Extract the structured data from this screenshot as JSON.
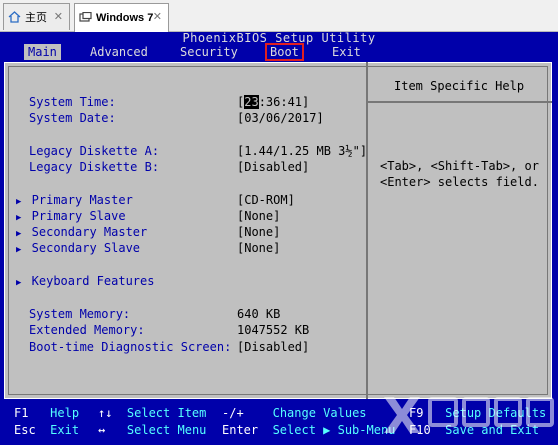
{
  "host": {
    "tabs": [
      {
        "label": "主页",
        "icon": "home-icon",
        "close": "✕"
      },
      {
        "label": "Windows 7",
        "icon": "vm-icon",
        "close": "✕"
      }
    ]
  },
  "bios": {
    "title": "PhoenixBIOS Setup Utility",
    "menu": [
      "Main",
      "Advanced",
      "Security",
      "Boot",
      "Exit"
    ],
    "active_menu": "Main",
    "highlighted_menu": "Boot",
    "fields": [
      {
        "label": "System Time:",
        "value_cursor": "23",
        "value_rest": ":36:41]",
        "value_prefix": "["
      },
      {
        "label": "System Date:",
        "value": "[03/06/2017]"
      },
      {
        "label": "Legacy Diskette A:",
        "value": "[1.44/1.25 MB  3½\"]"
      },
      {
        "label": "Legacy Diskette B:",
        "value": "[Disabled]"
      },
      {
        "label": "Primary Master",
        "value": "[CD-ROM]",
        "submenu": true
      },
      {
        "label": "Primary Slave",
        "value": "[None]",
        "submenu": true
      },
      {
        "label": "Secondary Master",
        "value": "[None]",
        "submenu": true
      },
      {
        "label": "Secondary Slave",
        "value": "[None]",
        "submenu": true
      },
      {
        "label": "Keyboard Features",
        "submenu": true
      },
      {
        "label": "System Memory:",
        "value": "640 KB"
      },
      {
        "label": "Extended Memory:",
        "value": "1047552 KB"
      },
      {
        "label": "Boot-time Diagnostic Screen:",
        "value": "[Disabled]"
      }
    ],
    "help": {
      "title": "Item Specific Help",
      "text": "<Tab>, <Shift-Tab>, or\n<Enter> selects field."
    },
    "footer": {
      "row1": [
        {
          "key": "F1",
          "desc": "Help"
        },
        {
          "key": "↑↓",
          "desc": "Select Item"
        },
        {
          "key": "-/+",
          "desc": "Change Values"
        },
        {
          "key": "F9",
          "desc": "Setup Defaults"
        }
      ],
      "row2": [
        {
          "key": "Esc",
          "desc": "Exit"
        },
        {
          "key": "↔",
          "desc": "Select Menu"
        },
        {
          "key": "Enter",
          "desc": "Select ▶ Sub-Menu"
        },
        {
          "key": "F10",
          "desc": "Save and Exit"
        }
      ]
    }
  },
  "colors": {
    "bios_blue": "#0000aa",
    "panel_gray": "#c0c0c0",
    "key_desc_cyan": "#55ffff",
    "highlight_red": "#e02020"
  },
  "watermark": {
    "text": "自由互联"
  }
}
